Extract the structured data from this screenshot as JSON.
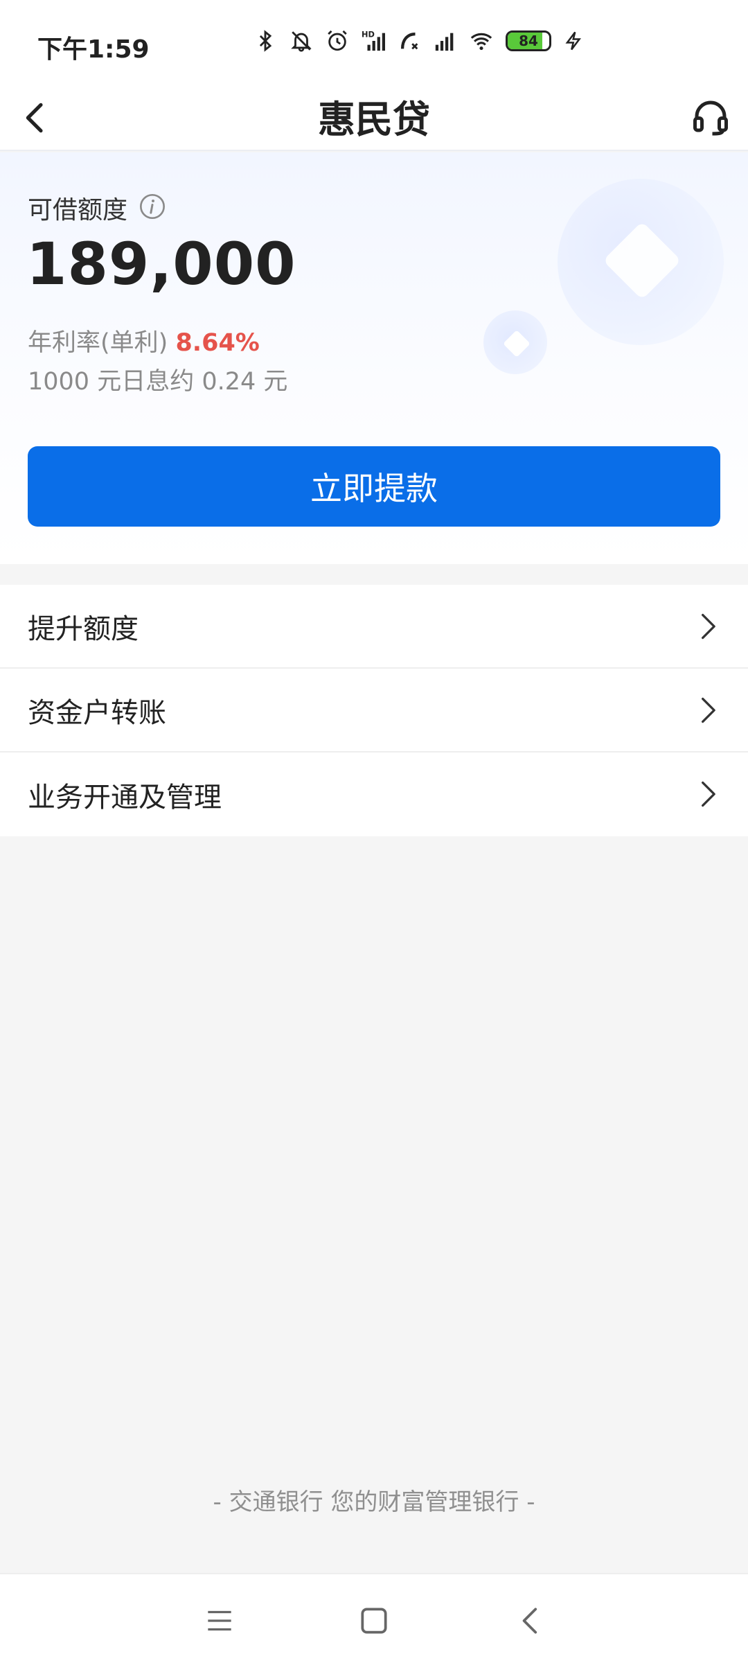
{
  "status_bar": {
    "time": "下午1:59",
    "battery_level": "84",
    "battery_fraction": 0.84,
    "battery_color": "#59c93a",
    "icons": [
      "bluetooth-icon",
      "bell-mute-icon",
      "alarm-icon",
      "hd-signal-icon",
      "call-icon",
      "signal-icon",
      "wifi-icon",
      "battery-icon",
      "charging-icon"
    ]
  },
  "nav": {
    "title": "惠民贷",
    "back_icon": "chevron-left-icon",
    "support_icon": "headset-icon"
  },
  "credit": {
    "limit_label": "可借额度",
    "limit_amount": "189,000",
    "rate_label": "年利率(单利)",
    "rate_value": "8.64%",
    "daily_interest": "1000 元日息约 0.24 元",
    "withdraw_button": "立即提款",
    "accent_color": "#0a6ee8",
    "rate_color": "#e5534b"
  },
  "menu": {
    "items": [
      {
        "label": "提升额度"
      },
      {
        "label": "资金户转账"
      },
      {
        "label": "业务开通及管理"
      }
    ]
  },
  "footer": {
    "slogan": "- 交通银行 您的财富管理银行 -"
  },
  "system_nav": {
    "buttons": [
      "menu-icon",
      "home-icon",
      "back-icon"
    ]
  }
}
